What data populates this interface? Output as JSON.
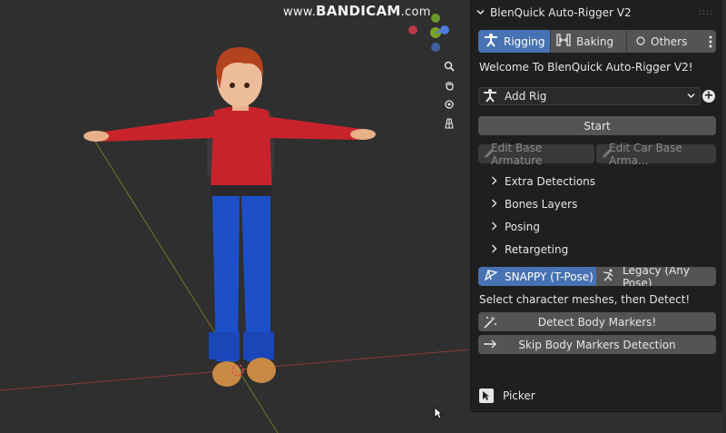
{
  "watermark": {
    "www": "www.",
    "brand": "BANDICAM",
    "tld": ".com"
  },
  "panel": {
    "title": "BlenQuick Auto-Rigger V2",
    "tabs": [
      {
        "label": "Rigging",
        "icon": "rig-figure-icon",
        "active": true
      },
      {
        "label": "Baking",
        "icon": "bake-icon",
        "active": false
      },
      {
        "label": "Others",
        "icon": "circle-icon",
        "active": false
      }
    ],
    "welcome": "Welcome To BlenQuick Auto-Rigger V2!",
    "rig_dropdown": {
      "value": "Add Rig"
    },
    "start_label": "Start",
    "edit_base_label": "Edit Base Armature",
    "edit_car_label": "Edit Car Base Arma...",
    "sections": [
      "Extra Detections",
      "Bones Layers",
      "Posing",
      "Retargeting"
    ],
    "pose_modes": [
      {
        "label": "SNAPPY (T-Pose)",
        "active": true
      },
      {
        "label": "Legacy (Any Pose)",
        "active": false
      }
    ],
    "hint": "Select character meshes, then Detect!",
    "detect_label": "Detect Body Markers!",
    "skip_label": "Skip Body Markers Detection",
    "picker_label": "Picker"
  },
  "colors": {
    "accent": "#4772b3",
    "panel_bg": "#1f1f1f",
    "button": "#545454",
    "viewport_bg": "#2f2f2f"
  }
}
